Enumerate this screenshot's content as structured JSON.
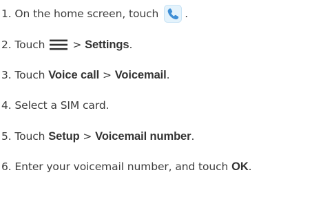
{
  "steps": [
    {
      "number": "1.",
      "text_before": "On the home screen, touch",
      "icon": "phone-app-icon",
      "text_after": "."
    },
    {
      "number": "2.",
      "text_before": "Touch",
      "icon": "menu-icon",
      "separator": ">",
      "bold_1": "Settings",
      "text_after": "."
    },
    {
      "number": "3.",
      "text_before": "Touch",
      "bold_1": "Voice call",
      "separator": ">",
      "bold_2": "Voicemail",
      "text_after": "."
    },
    {
      "number": "4.",
      "text_before": "Select a SIM card."
    },
    {
      "number": "5.",
      "text_before": "Touch",
      "bold_1": "Setup",
      "separator": ">",
      "bold_2": "Voicemail number",
      "text_after": "."
    },
    {
      "number": "6.",
      "text_before": "Enter your voicemail number, and touch",
      "bold_1": "OK",
      "text_after": "."
    }
  ],
  "colors": {
    "text": "#3c3c3c",
    "icon_blue": "#3f8fd6",
    "icon_bg": "#dff0fb"
  }
}
